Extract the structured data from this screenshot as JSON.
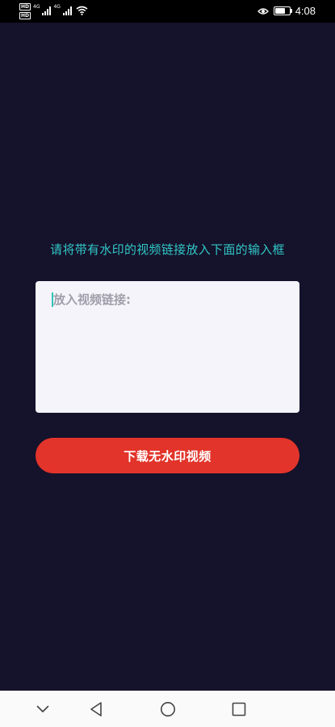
{
  "status_bar": {
    "time": "4:08",
    "hd_badges": [
      "HD",
      "HD"
    ],
    "network_labels": [
      "4G",
      "4G"
    ],
    "icons": [
      "signal-icon",
      "signal-icon",
      "wifi-icon",
      "eye-icon",
      "battery-icon"
    ],
    "battery_level": 0.8
  },
  "main": {
    "instruction": "请将带有水印的视频链接放入下面的输入框",
    "link_input": {
      "placeholder": "放入视频链接:",
      "value": ""
    },
    "download_button_label": "下载无水印视频",
    "colors": {
      "background": "#15122b",
      "instruction_text": "#31c7c6",
      "button": "#e2342a",
      "input_background": "#f5f4fb"
    }
  },
  "nav_bar": {
    "icons": [
      "chevron-down-icon",
      "back-triangle-icon",
      "home-circle-icon",
      "recent-square-icon"
    ]
  }
}
